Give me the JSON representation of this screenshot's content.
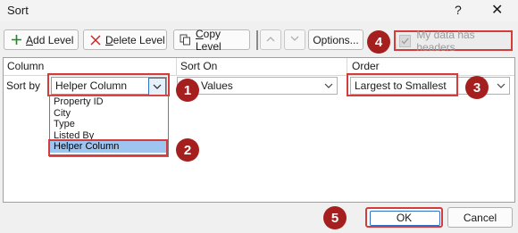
{
  "window": {
    "title": "Sort",
    "help": "?",
    "close": "✕"
  },
  "toolbar": {
    "add_level": "Add Level",
    "delete_level": "Delete Level",
    "copy_level": "Copy Level",
    "options": "Options...",
    "my_data_has_headers": "My data has headers"
  },
  "grid": {
    "headers": {
      "column": "Column",
      "sort_on": "Sort On",
      "order": "Order"
    },
    "row": {
      "label": "Sort by",
      "column_value": "Helper Column",
      "sort_on_value": "Values",
      "order_value": "Largest to Smallest"
    },
    "column_options": [
      "Property ID",
      "City",
      "Type",
      "Listed By",
      "Helper Column"
    ],
    "selected_option": "Helper Column"
  },
  "callouts": [
    "1",
    "2",
    "3",
    "4",
    "5"
  ],
  "footer": {
    "ok": "OK",
    "cancel": "Cancel"
  },
  "colors": {
    "callout": "#a51f1f",
    "highlight_border": "#d43c3c",
    "selection": "#9ec4f0"
  }
}
